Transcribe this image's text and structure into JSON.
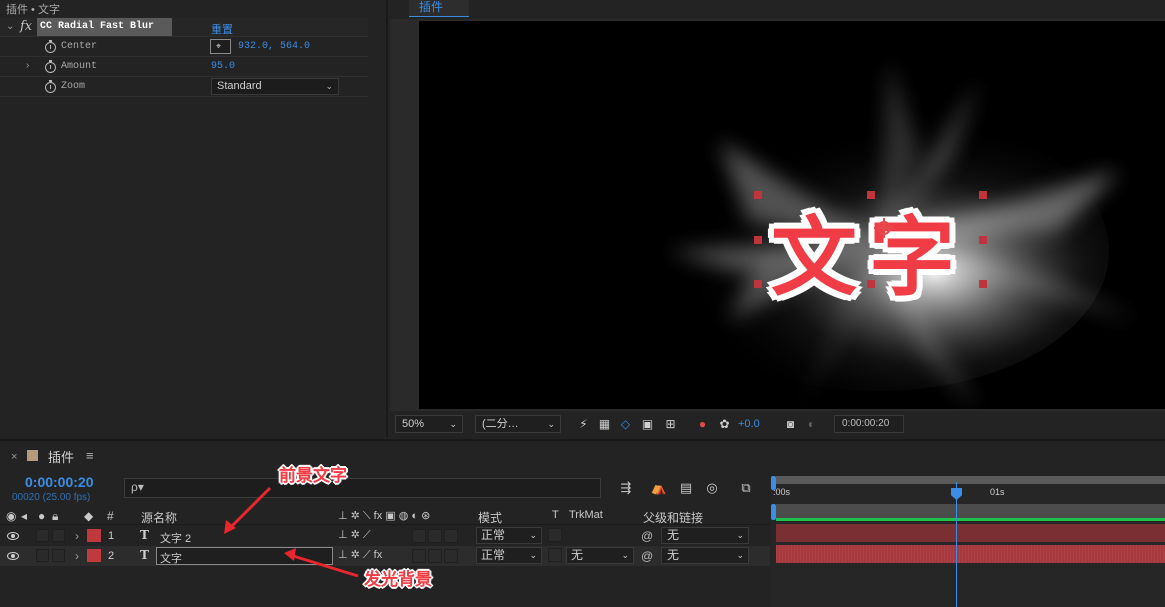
{
  "effect_controls": {
    "breadcrumb": "插件 • 文字",
    "effect_name": "CC Radial Fast Blur",
    "reset_label": "重置",
    "props": [
      {
        "label": "Center",
        "value": "932.0, 564.0"
      },
      {
        "label": "Amount",
        "value": "95.0"
      },
      {
        "label": "Zoom",
        "value": "Standard"
      }
    ]
  },
  "viewer": {
    "tab_label": "插件",
    "comp_text": "文字",
    "zoom": "50%",
    "resolution": "(二分…",
    "exposure": "+0.0",
    "current_time": "0:00:00:20"
  },
  "timeline": {
    "title": "插件",
    "timecode": "0:00:00:20",
    "fps": "00020 (25.00 fps)",
    "search_placeholder": "ρ▾",
    "columns": {
      "num": "#",
      "source_name": "源名称",
      "mode": "模式",
      "t": "T",
      "trkmat": "TrkMat",
      "parent": "父级和链接"
    },
    "layers": [
      {
        "num": "1",
        "name": "文字 2",
        "mode": "正常",
        "trkmat": "",
        "parent": "无"
      },
      {
        "num": "2",
        "name": "文字",
        "mode": "正常",
        "trkmat": "无",
        "parent": "无"
      }
    ],
    "ruler_labels": [
      ":00s",
      "01s"
    ]
  },
  "annotations": {
    "foreground": "前景文字",
    "glow_bg": "发光背景"
  }
}
